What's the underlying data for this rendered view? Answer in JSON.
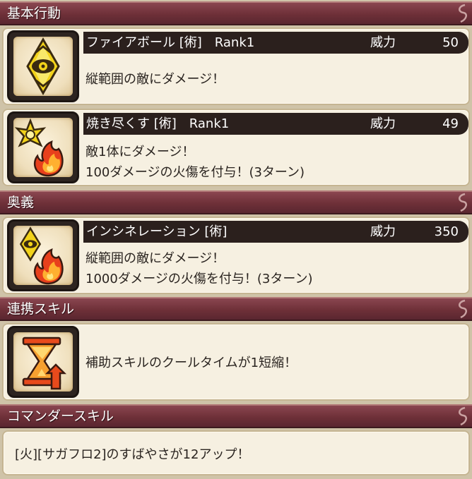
{
  "sections": {
    "basic": "基本行動",
    "ougi": "奥義",
    "link": "連携スキル",
    "commander": "コマンダースキル"
  },
  "skill1": {
    "name": "ファイアボール [術]　Rank1",
    "power_label": "威力",
    "power": "50",
    "desc1": "縦範囲の敵にダメージ！"
  },
  "skill2": {
    "name": "焼き尽くす [術]　Rank1",
    "power_label": "威力",
    "power": "49",
    "desc1": "敵1体にダメージ！",
    "desc2": "100ダメージの火傷を付与！(3ターン)"
  },
  "ultimate": {
    "name": "インシネレーション [術]",
    "power_label": "威力",
    "power": "350",
    "desc1": "縦範囲の敵にダメージ！",
    "desc2": "1000ダメージの火傷を付与！(3ターン)"
  },
  "link_skill": {
    "desc": "補助スキルのクールタイムが1短縮！"
  },
  "commander_skill": {
    "desc": "[火][サガフロ2]のすばやさが12アップ！"
  },
  "colors": {
    "header": "#6e3038",
    "titlebar": "#2b201d",
    "panel": "#f6f0e1",
    "fire": "#e8401c",
    "gold": "#f2d21a"
  },
  "icons": {
    "skill1": "eye-diamond-icon",
    "skill2": "star-fire-icon",
    "ultimate": "eye-fire-icon",
    "link_skill": "hourglass-arrow-icon"
  }
}
